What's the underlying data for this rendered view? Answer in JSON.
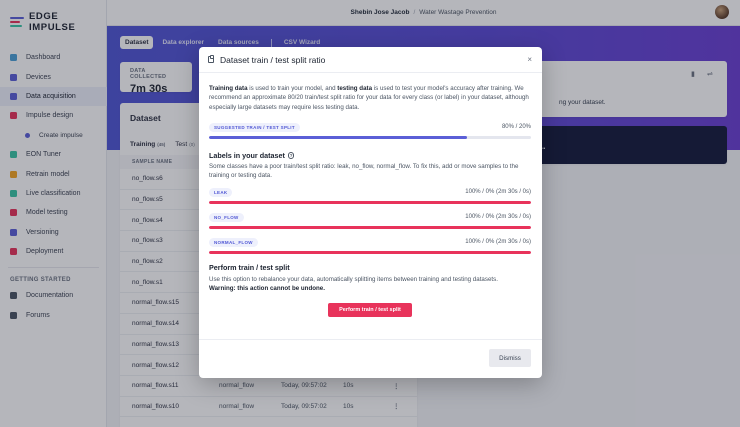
{
  "brand": {
    "name": "EDGE IMPULSE",
    "colors": [
      "#5b5fd7",
      "#e8335b",
      "#38c6a5"
    ]
  },
  "topbar": {
    "user": "Shebin Jose Jacob",
    "separator": "/",
    "project": "Water Wastage Prevention"
  },
  "sidebar": {
    "items": [
      {
        "label": "Dashboard",
        "icon": "monitor-icon",
        "color": "#4b9fd6"
      },
      {
        "label": "Devices",
        "icon": "device-icon",
        "color": "#5b5fd7"
      },
      {
        "label": "Data acquisition",
        "icon": "database-icon",
        "color": "#5b5fd7",
        "active": true
      },
      {
        "label": "Impulse design",
        "icon": "pulse-icon",
        "color": "#e8335b"
      },
      {
        "label": "Create impulse",
        "icon": "dot-icon",
        "color": "#5b5fd7",
        "sub": true
      },
      {
        "label": "EON Tuner",
        "icon": "eon-icon",
        "color": "#38c6a5"
      },
      {
        "label": "Retrain model",
        "icon": "retrain-icon",
        "color": "#f5a623"
      },
      {
        "label": "Live classification",
        "icon": "live-icon",
        "color": "#38c6a5"
      },
      {
        "label": "Model testing",
        "icon": "testing-icon",
        "color": "#e8335b"
      },
      {
        "label": "Versioning",
        "icon": "branch-icon",
        "color": "#5b5fd7"
      },
      {
        "label": "Deployment",
        "icon": "deploy-icon",
        "color": "#e8335b"
      }
    ],
    "section": "GETTING STARTED",
    "getting_started": [
      {
        "label": "Documentation",
        "icon": "book-icon",
        "color": "#4b5563"
      },
      {
        "label": "Forums",
        "icon": "forum-icon",
        "color": "#4b5563"
      }
    ]
  },
  "tabs": [
    {
      "label": "Dataset",
      "active": true
    },
    {
      "label": "Data explorer"
    },
    {
      "label": "Data sources"
    },
    {
      "label": "CSV Wizard"
    }
  ],
  "stat": {
    "label": "DATA COLLECTED",
    "value": "7m 30s"
  },
  "dataset": {
    "title": "Dataset",
    "tab_training": "Training",
    "tab_training_count": "(45)",
    "tab_test": "Test",
    "tab_test_count": "(0)",
    "column_header": "SAMPLE NAME",
    "rows": [
      {
        "name": "no_flow.s6"
      },
      {
        "name": "no_flow.s5"
      },
      {
        "name": "no_flow.s4"
      },
      {
        "name": "no_flow.s3"
      },
      {
        "name": "no_flow.s2"
      },
      {
        "name": "no_flow.s1"
      },
      {
        "name": "normal_flow.s15"
      },
      {
        "name": "normal_flow.s14"
      },
      {
        "name": "normal_flow.s13"
      },
      {
        "name": "normal_flow.s12"
      },
      {
        "name": "normal_flow.s11",
        "label": "normal_flow",
        "time": "Today, 09:57:02",
        "length": "10s"
      },
      {
        "name": "normal_flow.s10",
        "label": "normal_flow",
        "time": "Today, 09:57:02",
        "length": "10s"
      }
    ]
  },
  "right_card": {
    "text": "ng your dataset."
  },
  "dark_card": {
    "text": "..."
  },
  "modal": {
    "title": "Dataset train / test split ratio",
    "close": "×",
    "intro_b1": "Training data",
    "intro_t1": " is used to train your model, and ",
    "intro_b2": "testing data",
    "intro_t2": " is used to test your model's accuracy after training. We recommend an approximate 80/20 train/test split ratio for your data for every class (or label) in your dataset, although especially large datasets may require less testing data.",
    "suggested": {
      "label": "SUGGESTED TRAIN / TEST SPLIT",
      "value": "80% / 20%",
      "train_fraction": 0.8,
      "color": "#5b5fd7"
    },
    "labels_title": "Labels in your dataset",
    "labels_note": "Some classes have a poor train/test split ratio: leak, no_flow, normal_flow. To fix this, add or move samples to the training or testing data.",
    "labels": [
      {
        "label": "LEAK",
        "value": "100% / 0% (2m 30s / 0s)",
        "train_fraction": 1.0,
        "color": "#e8335b"
      },
      {
        "label": "NO_FLOW",
        "value": "100% / 0% (2m 30s / 0s)",
        "train_fraction": 1.0,
        "color": "#e8335b"
      },
      {
        "label": "NORMAL_FLOW",
        "value": "100% / 0% (2m 30s / 0s)",
        "train_fraction": 1.0,
        "color": "#e8335b"
      }
    ],
    "perform_title": "Perform train / test split",
    "perform_text": "Use this option to rebalance your data, automatically splitting items between training and testing datasets.",
    "warning": "Warning: this action cannot be undone.",
    "perform_button": "Perform train / test split",
    "dismiss_button": "Dismiss"
  }
}
